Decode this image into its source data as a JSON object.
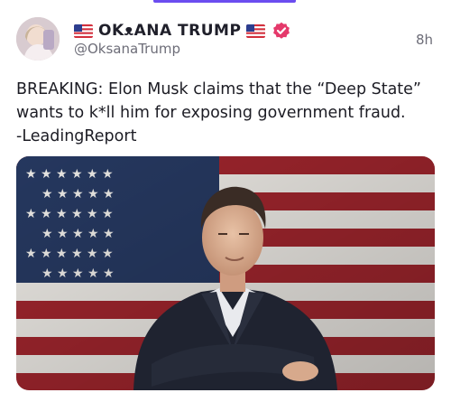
{
  "post": {
    "author": {
      "display_name": "OKᴥANA TRUMP",
      "handle": "@OksanaTrump",
      "avatar_icon": "avatar-photo",
      "verified_icon": "verified-badge-icon",
      "name_flag_icon": "us-flag-emoji-icon"
    },
    "timestamp": "8h",
    "text_lines": [
      "BREAKING: Elon Musk claims that the “Deep State”",
      "wants to k*ll him for exposing government fraud.",
      "-LeadingReport"
    ],
    "media": {
      "description_icon": "photo-man-in-front-of-american-flag"
    }
  },
  "colors": {
    "accent": "#6b4df0",
    "verified": "#e5396b",
    "text": "#1c1c24",
    "muted": "#6d6d78"
  }
}
